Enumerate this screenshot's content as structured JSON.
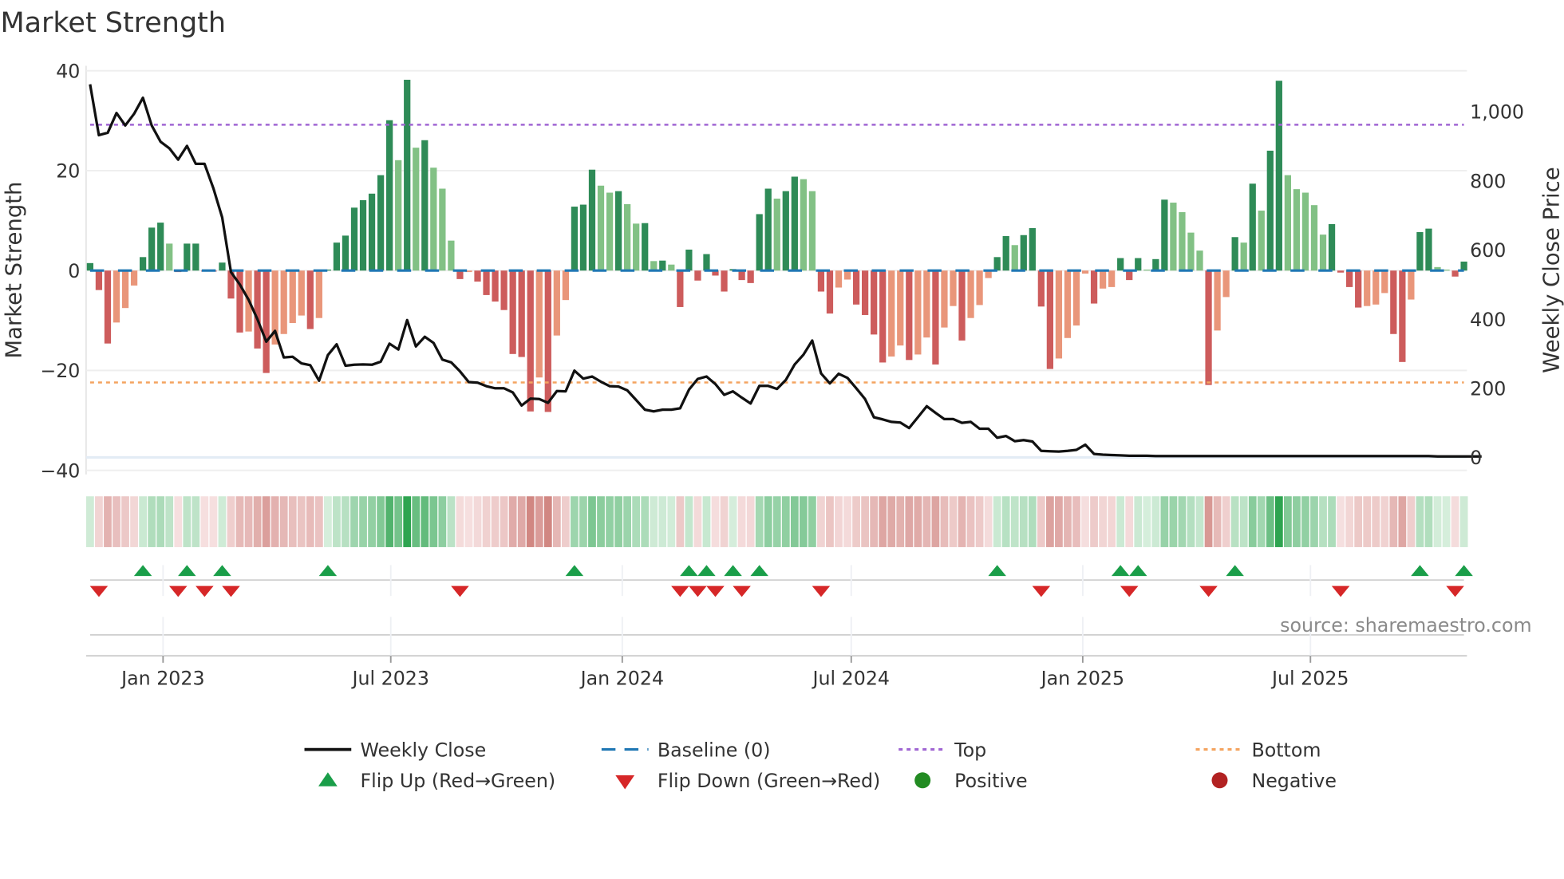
{
  "chart_data": {
    "type": "bar",
    "title": "Market Strength",
    "ylabel": "Market Strength",
    "y2label": "Weekly Close Price",
    "start_date": "2022-11-04",
    "frequency": "weekly",
    "ylim": [
      -40,
      40
    ],
    "y2lim": [
      -37,
      1118
    ],
    "top_level": 29.2,
    "bottom_level": -22.4,
    "yticks": [
      {
        "value": 40,
        "label": "40"
      },
      {
        "value": 20,
        "label": "20"
      },
      {
        "value": 0,
        "label": "0"
      },
      {
        "value": -20,
        "label": "−20"
      },
      {
        "value": -40,
        "label": "−40"
      }
    ],
    "y2ticks": [
      {
        "value": 0,
        "label": "0"
      },
      {
        "value": 200,
        "label": "200"
      },
      {
        "value": 400,
        "label": "400"
      },
      {
        "value": 600,
        "label": "600"
      },
      {
        "value": 800,
        "label": "800"
      },
      {
        "value": 1000,
        "label": "1,000"
      }
    ],
    "xticks": [
      {
        "date": "2023-01-01",
        "label": "Jan 2023"
      },
      {
        "date": "2023-07-01",
        "label": "Jul 2023"
      },
      {
        "date": "2024-01-01",
        "label": "Jan 2024"
      },
      {
        "date": "2024-07-01",
        "label": "Jul 2024"
      },
      {
        "date": "2025-01-01",
        "label": "Jan 2025"
      },
      {
        "date": "2025-07-01",
        "label": "Jul 2025"
      }
    ],
    "strength": [
      1.5,
      -3.9,
      -14.6,
      -10.4,
      -7.5,
      -3.0,
      2.7,
      8.6,
      9.6,
      5.4,
      -0.3,
      5.4,
      5.4,
      -0.2,
      -0.2,
      1.6,
      -5.6,
      -12.4,
      -12.2,
      -15.6,
      -20.5,
      -14.8,
      -12.7,
      -10.5,
      -9.0,
      -11.7,
      -9.5,
      0.2,
      5.6,
      7.0,
      12.6,
      14.1,
      15.4,
      19.1,
      30.1,
      22.1,
      38.2,
      24.6,
      26.1,
      20.6,
      16.4,
      6.0,
      -1.7,
      -0.3,
      -2.2,
      -4.9,
      -6.2,
      -7.9,
      -16.7,
      -17.3,
      -28.2,
      -21.4,
      -28.3,
      -13.0,
      -5.9,
      12.8,
      13.2,
      20.2,
      17.0,
      15.6,
      15.9,
      13.3,
      9.4,
      9.5,
      1.9,
      2.0,
      1.2,
      -7.3,
      4.2,
      -2.0,
      3.3,
      -1.0,
      -4.2,
      0.3,
      -1.9,
      -2.5,
      11.3,
      16.4,
      14.4,
      15.9,
      18.8,
      18.3,
      15.9,
      -4.2,
      -8.6,
      -3.4,
      -1.8,
      -6.8,
      -8.9,
      -12.8,
      -18.4,
      -17.2,
      -15.0,
      -17.9,
      -16.8,
      -13.4,
      -18.8,
      -11.4,
      -7.1,
      -14.0,
      -9.5,
      -6.9,
      -1.5,
      2.7,
      6.9,
      5.1,
      7.1,
      8.5,
      -7.2,
      -19.7,
      -17.6,
      -13.5,
      -11.0,
      -0.6,
      -6.6,
      -3.6,
      -3.3,
      2.5,
      -1.9,
      2.5,
      0.2,
      2.3,
      14.2,
      13.6,
      11.7,
      7.6,
      4.0,
      -22.9,
      -12.0,
      -5.3,
      6.7,
      5.6,
      17.4,
      12.0,
      24.0,
      38.0,
      19.1,
      16.3,
      15.6,
      13.1,
      7.2,
      9.3,
      -0.4,
      -3.3,
      -7.4,
      -7.1,
      -6.8,
      -4.5,
      -12.7,
      -18.3,
      -5.8,
      7.7,
      8.4,
      0.7,
      0.2,
      -1.2,
      1.8
    ],
    "close": [
      1079,
      932,
      939,
      996,
      960,
      994,
      1040,
      960,
      913,
      894,
      861,
      901,
      849,
      849,
      778,
      694,
      536,
      500,
      456,
      400,
      335,
      366,
      289,
      291,
      272,
      267,
      222,
      296,
      327,
      265,
      268,
      269,
      268,
      277,
      329,
      312,
      397,
      321,
      349,
      331,
      283,
      275,
      249,
      218,
      216,
      206,
      200,
      200,
      188,
      150,
      170,
      169,
      158,
      192,
      191,
      251,
      228,
      234,
      219,
      206,
      205,
      194,
      166,
      138,
      133,
      138,
      138,
      142,
      196,
      227,
      234,
      212,
      181,
      191,
      173,
      156,
      207,
      207,
      198,
      224,
      269,
      297,
      338,
      243,
      214,
      242,
      230,
      200,
      169,
      116,
      110,
      103,
      101,
      85,
      116,
      148,
      129,
      111,
      111,
      100,
      103,
      83,
      83,
      57,
      62,
      47,
      50,
      46,
      19,
      18,
      17,
      19,
      22,
      37,
      10,
      8,
      7,
      6,
      5,
      5,
      5,
      4,
      4,
      4,
      4,
      4,
      4,
      4,
      4,
      4,
      4,
      4,
      4,
      4,
      4,
      4,
      4,
      4,
      4,
      4,
      4,
      4,
      4,
      4,
      4,
      4,
      4,
      4,
      4,
      4,
      4,
      4,
      4,
      3,
      3,
      3,
      3,
      3,
      3
    ],
    "legend": {
      "weekly_close": "Weekly Close",
      "baseline": "Baseline (0)",
      "top": "Top",
      "bottom": "Bottom",
      "flip_up": "Flip Up (Red→Green)",
      "flip_down": "Flip Down (Green→Red)",
      "positive": "Positive",
      "negative": "Negative"
    },
    "source": "source: sharemaestro.com",
    "colors": {
      "pos_dark": "#2e8b57",
      "pos_light": "#82c185",
      "neg_dark": "#cd5c5c",
      "neg_light": "#e9967a",
      "baseline": "#1f77b4",
      "top": "#a066d3",
      "bottom": "#f4a460",
      "close": "#111111",
      "flip_up": "#1a9e49",
      "flip_down": "#d62728",
      "positive": "#228b22",
      "negative": "#b22222"
    }
  }
}
